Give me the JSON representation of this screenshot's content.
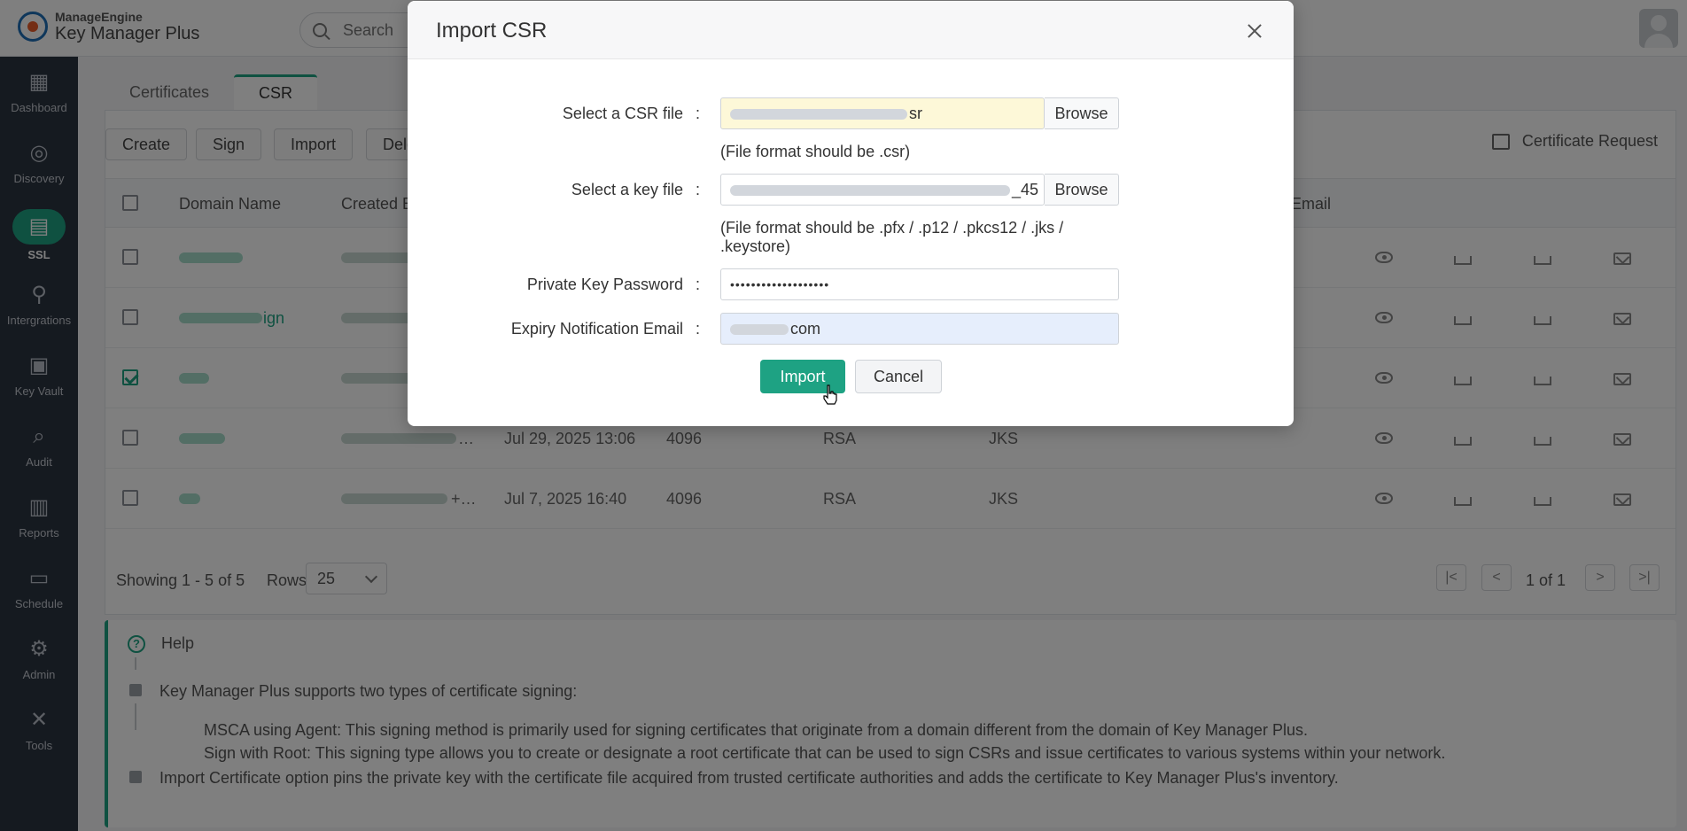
{
  "header": {
    "brand": "ManageEngine",
    "product": "Key Manager Plus",
    "search_placeholder": "Search"
  },
  "sidebar": {
    "items": [
      {
        "label": "Dashboard",
        "icon": "dashboard-icon"
      },
      {
        "label": "Discovery",
        "icon": "compass-icon"
      },
      {
        "label": "SSL",
        "icon": "certificate-icon"
      },
      {
        "label": "Intergrations",
        "icon": "plug-icon"
      },
      {
        "label": "Key Vault",
        "icon": "vault-icon"
      },
      {
        "label": "Audit",
        "icon": "audit-icon"
      },
      {
        "label": "Reports",
        "icon": "reports-icon"
      },
      {
        "label": "Schedule",
        "icon": "calendar-icon"
      },
      {
        "label": "Admin",
        "icon": "gear-icon"
      },
      {
        "label": "Tools",
        "icon": "tools-icon"
      }
    ]
  },
  "tabs": [
    {
      "label": "Certificates"
    },
    {
      "label": "CSR"
    }
  ],
  "toolbar": {
    "create": "Create",
    "sign": "Sign",
    "import": "Import",
    "delete": "Dele",
    "cert_request": "Certificate Request"
  },
  "table": {
    "headers": {
      "domain": "Domain Name",
      "created_by": "Created B",
      "email": "Email"
    },
    "rows": [
      {
        "domain_tail": "",
        "created": "",
        "key_size": "",
        "algorithm": "",
        "store": ""
      },
      {
        "domain_tail": "ign",
        "created": "",
        "key_size": "",
        "algorithm": "",
        "store": ""
      },
      {
        "domain_tail": "",
        "created": "",
        "key_size": "",
        "algorithm": "",
        "store": ""
      },
      {
        "domain_tail": "",
        "created_tail": "…",
        "created": "Jul 29, 2025 13:06",
        "key_size": "4096",
        "algorithm": "RSA",
        "store": "JKS"
      },
      {
        "domain_tail": "",
        "created_tail": "+…",
        "created": "Jul 7, 2025 16:40",
        "key_size": "4096",
        "algorithm": "RSA",
        "store": "JKS"
      }
    ]
  },
  "pagination": {
    "showing": "Showing 1 - 5 of 5",
    "rows_label": "Rows",
    "rows_value": "25",
    "page": "1 of 1"
  },
  "help": {
    "title": "Help",
    "line1": "Key Manager Plus supports two types of certificate signing:",
    "line2": "MSCA using Agent: This signing method is primarily used for signing certificates that originate from a domain different from the domain of Key Manager Plus.",
    "line3": "Sign with Root: This signing type allows you to create or designate a root certificate that can be used to sign CSRs and issue certificates to various systems within your network.",
    "line4": "Import Certificate option pins the private key with the certificate file acquired from trusted certificate authorities and adds the certificate to Key Manager Plus's inventory."
  },
  "modal": {
    "title": "Import CSR",
    "csr_label": "Select a CSR file",
    "csr_value_tail": "sr",
    "csr_hint": "(File format should be .csr)",
    "key_label": "Select a key file",
    "key_value_tail": "_45",
    "key_hint_line1": "(File format should be .pfx / .p12 / .pkcs12 / .jks /",
    "key_hint_line2": ".keystore)",
    "browse": "Browse",
    "password_label": "Private Key Password",
    "password_value": "•••••••••••••••••••",
    "email_label": "Expiry Notification Email",
    "email_value_tail": "com",
    "colon": ":",
    "import_button": "Import",
    "cancel_button": "Cancel"
  },
  "colors": {
    "accent": "#1ea283",
    "sidebar": "#2b3440"
  }
}
